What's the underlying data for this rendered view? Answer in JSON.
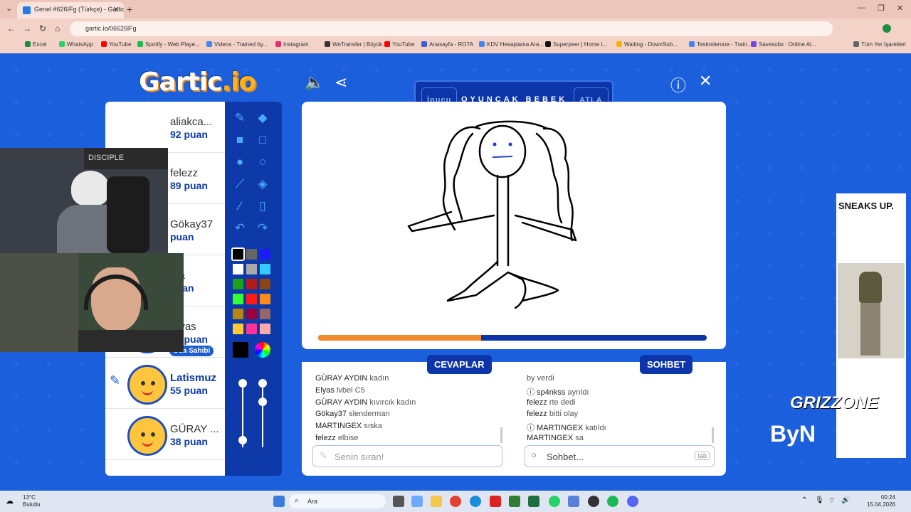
{
  "browser": {
    "tab_title": "Genel #626IFg (Türkçe) - Gartic",
    "tab_close": "✕",
    "new_tab": "+",
    "url": "gartic.io/06626lFg",
    "window_controls": [
      "—",
      "❐",
      "✕"
    ],
    "bookmarks": [
      "Excel",
      "WhatsApp",
      "YouTube",
      "Spotify - Web Playe...",
      "Videos - Trained by...",
      "Instagram",
      "WeTransfer | Büyük...",
      "YouTube",
      "Anasayfa - ROTA",
      "KDV Hesaplama Ara...",
      "Superpeer | Home t...",
      "Waiting - DownSub...",
      "Testosterone - Train...",
      "Savesubs : Online Al...",
      "Tüm Yer İşaretleri"
    ],
    "bookmark_colors": [
      "#1e8e3e",
      "#25d366",
      "#ff0000",
      "#1db954",
      "#4285f4",
      "#e1306c",
      "#333333",
      "#ff0000",
      "#3b5bdb",
      "#4285f4",
      "#111111",
      "#f4b400",
      "#4285f4",
      "#7048e8",
      "#666666"
    ]
  },
  "game": {
    "logo_main": "Gartic",
    "logo_suffix": ".io",
    "hint": {
      "button": "İpucu",
      "word": "OYUNCAK  BEBEK",
      "skip": "ATLA"
    },
    "players": [
      {
        "name": "aliakca...",
        "score": "92 puan"
      },
      {
        "name": "felezz",
        "score": "89 puan"
      },
      {
        "name": "Gökay37",
        "score": "puan"
      },
      {
        "name": "rza",
        "score": "puan"
      },
      {
        "name": "Elyas",
        "score": "68 puan",
        "badge": "Oda Sahibi"
      },
      {
        "name": "Latismuz",
        "score": "55 puan"
      },
      {
        "name": "GÜRAY ...",
        "score": "38 puan"
      }
    ],
    "colors": [
      "#000000",
      "#666666",
      "#1a1aff",
      "#ffffff",
      "#aaaaaa",
      "#33ccff",
      "#1aa31a",
      "#b31a1a",
      "#8b4513",
      "#33ff33",
      "#ff1a1a",
      "#ff8c1a",
      "#b8860b",
      "#99003d",
      "#996666",
      "#ffcc33",
      "#ff3399",
      "#ffaaaa"
    ],
    "timer_progress": 0.42,
    "answers_title": "CEVAPLAR",
    "chat_title": "SOHBET",
    "answers": [
      {
        "user": "GÜRAY AYDIN",
        "text": "kadın"
      },
      {
        "user": "Elyas",
        "text": "lvbel C5"
      },
      {
        "user": "GÜRAY AYDIN",
        "text": "kıvırcık kadın"
      },
      {
        "user": "Gökay37",
        "text": "slenderman"
      },
      {
        "user": "MARTINGEX",
        "text": "sıska"
      },
      {
        "user": "felezz",
        "text": "elbise"
      }
    ],
    "chat": [
      {
        "user": "",
        "text": "by verdi",
        "system": true
      },
      {
        "user": "ⓘ sp4nkss",
        "text": "ayrıldı",
        "system": true
      },
      {
        "user": "felezz",
        "text": "rte dedi"
      },
      {
        "user": "felezz",
        "text": "bitti olay"
      },
      {
        "user": "ⓘ MARTINGEX",
        "text": "katıldı",
        "system": true
      },
      {
        "user": "MARTINGEX",
        "text": "sa"
      }
    ],
    "answer_placeholder": "Senin sıran!",
    "chat_placeholder": "Sohbet...",
    "chat_key": "tab"
  },
  "overlay": {
    "ad_title": "SNEAKS UP.",
    "grizzone": "GRIZZONE",
    "byno": "ByN",
    "webcam_banner": "DISCIPLE"
  },
  "taskbar": {
    "weather_temp": "13°C",
    "weather_desc": "Bulutlu",
    "search": "Ara",
    "time": "00:24",
    "date": "15.04.2026"
  }
}
